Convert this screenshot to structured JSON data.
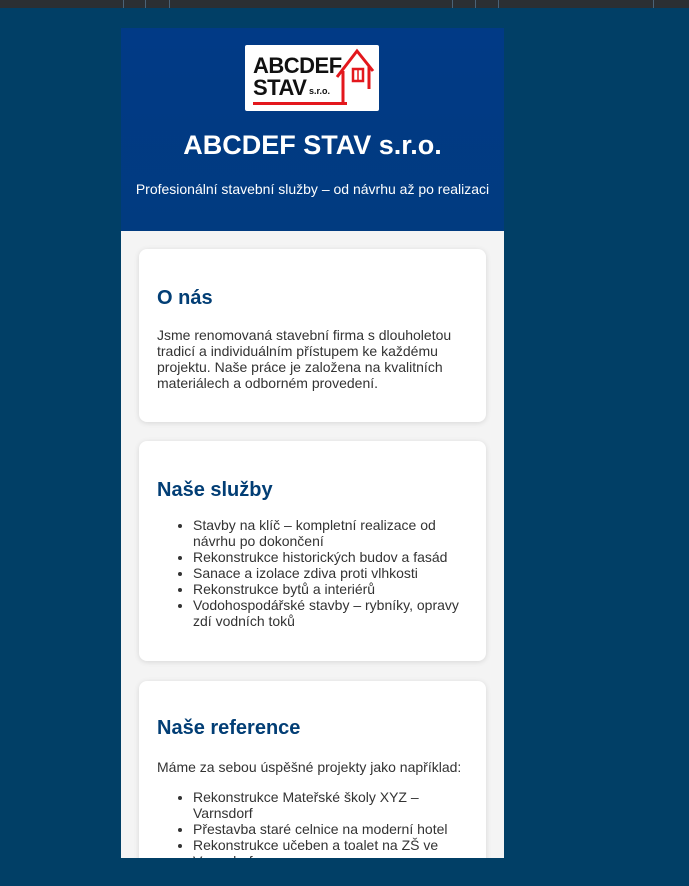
{
  "colors": {
    "page_background": "#013f66",
    "hero_background": "#013a86",
    "heading": "#023e75",
    "logo_accent": "#e3171c"
  },
  "logo": {
    "line1": "ABCDEF",
    "line2": "STAV",
    "suffix": "s.r.o.",
    "icon": "house-icon"
  },
  "header": {
    "title": "ABCDEF STAV s.r.o.",
    "tagline": "Profesionální stavební služby – od návrhu až po realizaci"
  },
  "about": {
    "heading": "O nás",
    "text": "Jsme renomovaná stavební firma s dlouholetou tradicí a individuálním přístupem ke každému projektu. Naše práce je založena na kvalitních materiálech a odborném provedení."
  },
  "services": {
    "heading": "Naše služby",
    "items": [
      "Stavby na klíč – kompletní realizace od návrhu po dokončení",
      "Rekonstrukce historických budov a fasád",
      "Sanace a izolace zdiva proti vlhkosti",
      "Rekonstrukce bytů a interiérů",
      "Vodohospodářské stavby – rybníky, opravy zdí vodních toků"
    ]
  },
  "references": {
    "heading": "Naše reference",
    "intro": "Máme za sebou úspěšné projekty jako například:",
    "items": [
      "Rekonstrukce Mateřské školy XYZ – Varnsdorf",
      "Přestavba staré celnice na moderní hotel",
      "Rekonstrukce učeben a toalet na ZŠ ve Varnsdorfu"
    ]
  }
}
